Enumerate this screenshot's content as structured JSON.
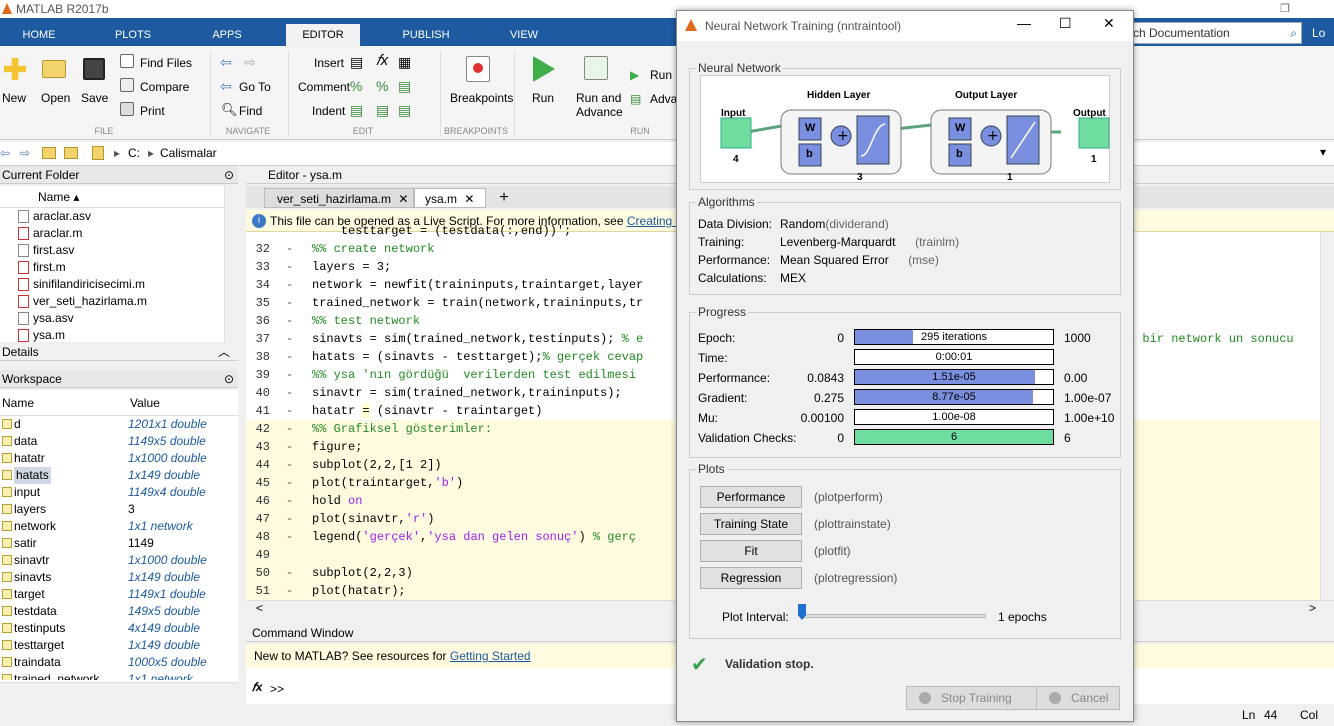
{
  "app": {
    "title": "MATLAB R2017b"
  },
  "tabs": [
    "HOME",
    "PLOTS",
    "APPS",
    "EDITOR",
    "PUBLISH",
    "VIEW"
  ],
  "search": {
    "placeholder": "rch Documentation",
    "login": "Lo"
  },
  "ribbon": {
    "new": "New",
    "open": "Open",
    "save": "Save",
    "find_files": "Find Files",
    "compare": "Compare",
    "print": "Print",
    "go_to": "Go To",
    "find": "Find",
    "insert": "Insert",
    "comment": "Comment",
    "indent": "Indent",
    "breakpoints": "Breakpoints",
    "run": "Run",
    "run_advance": "Run and Advance",
    "run_section": "Run",
    "advance": "Adva",
    "sections": {
      "file": "FILE",
      "navigate": "NAVIGATE",
      "edit": "EDIT",
      "breakpoints": "BREAKPOINTS",
      "run": "RUN"
    }
  },
  "path": {
    "drive": "C:",
    "folder": "Calismalar"
  },
  "current_folder": {
    "title": "Current Folder",
    "col": "Name",
    "files": [
      "araclar.asv",
      "araclar.m",
      "first.asv",
      "first.m",
      "sinifilandiricisecimi.m",
      "ver_seti_hazirlama.m",
      "ysa.asv",
      "ysa.m"
    ]
  },
  "details": {
    "title": "Details"
  },
  "workspace": {
    "title": "Workspace",
    "col_name": "Name",
    "col_value": "Value",
    "vars": [
      {
        "name": "d",
        "value": "1201x1 double"
      },
      {
        "name": "data",
        "value": "1149x5 double"
      },
      {
        "name": "hatatr",
        "value": "1x1000 double"
      },
      {
        "name": "hatats",
        "value": "1x149 double"
      },
      {
        "name": "input",
        "value": "1149x4 double"
      },
      {
        "name": "layers",
        "value": "3"
      },
      {
        "name": "network",
        "value": "1x1 network"
      },
      {
        "name": "satir",
        "value": "1149"
      },
      {
        "name": "sinavtr",
        "value": "1x1000 double"
      },
      {
        "name": "sinavts",
        "value": "1x149 double"
      },
      {
        "name": "target",
        "value": "1149x1 double"
      },
      {
        "name": "testdata",
        "value": "149x5 double"
      },
      {
        "name": "testinputs",
        "value": "4x149 double"
      },
      {
        "name": "testtarget",
        "value": "1x149 double"
      },
      {
        "name": "traindata",
        "value": "1000x5 double"
      },
      {
        "name": "trained_network",
        "value": "1x1 network"
      }
    ]
  },
  "editor": {
    "title": "Editor - ysa.m",
    "tab1": "ver_seti_hazirlama.m",
    "tab2": "ysa.m",
    "info": "This file can be opened as a Live Script. For more information, see",
    "info_link": "Creating Li",
    "tail_comment": "ş bir network un sonucu"
  },
  "command": {
    "title": "Command Window",
    "msg": "New to MATLAB? See resources for",
    "link": "Getting Started",
    "prompt": ">>"
  },
  "status": {
    "ln_label": "Ln",
    "ln": "44",
    "col_label": "Col"
  },
  "nnt": {
    "title": "Neural Network Training (nntraintool)",
    "nn_title": "Neural Network",
    "hidden": "Hidden Layer",
    "output_layer": "Output Layer",
    "input": "Input",
    "output": "Output",
    "input_n": "4",
    "hidden_n": "3",
    "out_n": "1",
    "output_n": "1",
    "w": "W",
    "b": "b",
    "alg_title": "Algorithms",
    "alg": [
      {
        "k": "Data Division:",
        "v": "Random",
        "f": "(dividerand)"
      },
      {
        "k": "Training:",
        "v": "Levenberg-Marquardt",
        "f": "(trainlm)"
      },
      {
        "k": "Performance:",
        "v": "Mean Squared Error",
        "f": "(mse)"
      },
      {
        "k": "Calculations:",
        "v": "MEX",
        "f": ""
      }
    ],
    "prog_title": "Progress",
    "progress": [
      {
        "label": "Epoch:",
        "min": "0",
        "bar": "295 iterations",
        "max": "1000",
        "fill": 0.295,
        "color": "#7a8fe0"
      },
      {
        "label": "Time:",
        "min": "",
        "bar": "0:00:01",
        "max": "",
        "fill": 0,
        "color": "#7a8fe0"
      },
      {
        "label": "Performance:",
        "min": "0.0843",
        "bar": "1.51e-05",
        "max": "0.00",
        "fill": 0.91,
        "color": "#7a8fe0"
      },
      {
        "label": "Gradient:",
        "min": "0.275",
        "bar": "8.77e-05",
        "max": "1.00e-07",
        "fill": 0.9,
        "color": "#7a8fe0"
      },
      {
        "label": "Mu:",
        "min": "0.00100",
        "bar": "1.00e-08",
        "max": "1.00e+10",
        "fill": 0,
        "color": "#7a8fe0"
      },
      {
        "label": "Validation Checks:",
        "min": "0",
        "bar": "6",
        "max": "6",
        "fill": 1.0,
        "color": "#6fdca0"
      }
    ],
    "plots_title": "Plots",
    "plots": [
      {
        "btn": "Performance",
        "f": "(plotperform)"
      },
      {
        "btn": "Training State",
        "f": "(plottrainstate)"
      },
      {
        "btn": "Fit",
        "f": "(plotfit)"
      },
      {
        "btn": "Regression",
        "f": "(plotregression)"
      }
    ],
    "interval_label": "Plot Interval:",
    "interval_value": "1 epochs",
    "status": "Validation stop.",
    "stop": "Stop Training",
    "cancel": "Cancel"
  }
}
